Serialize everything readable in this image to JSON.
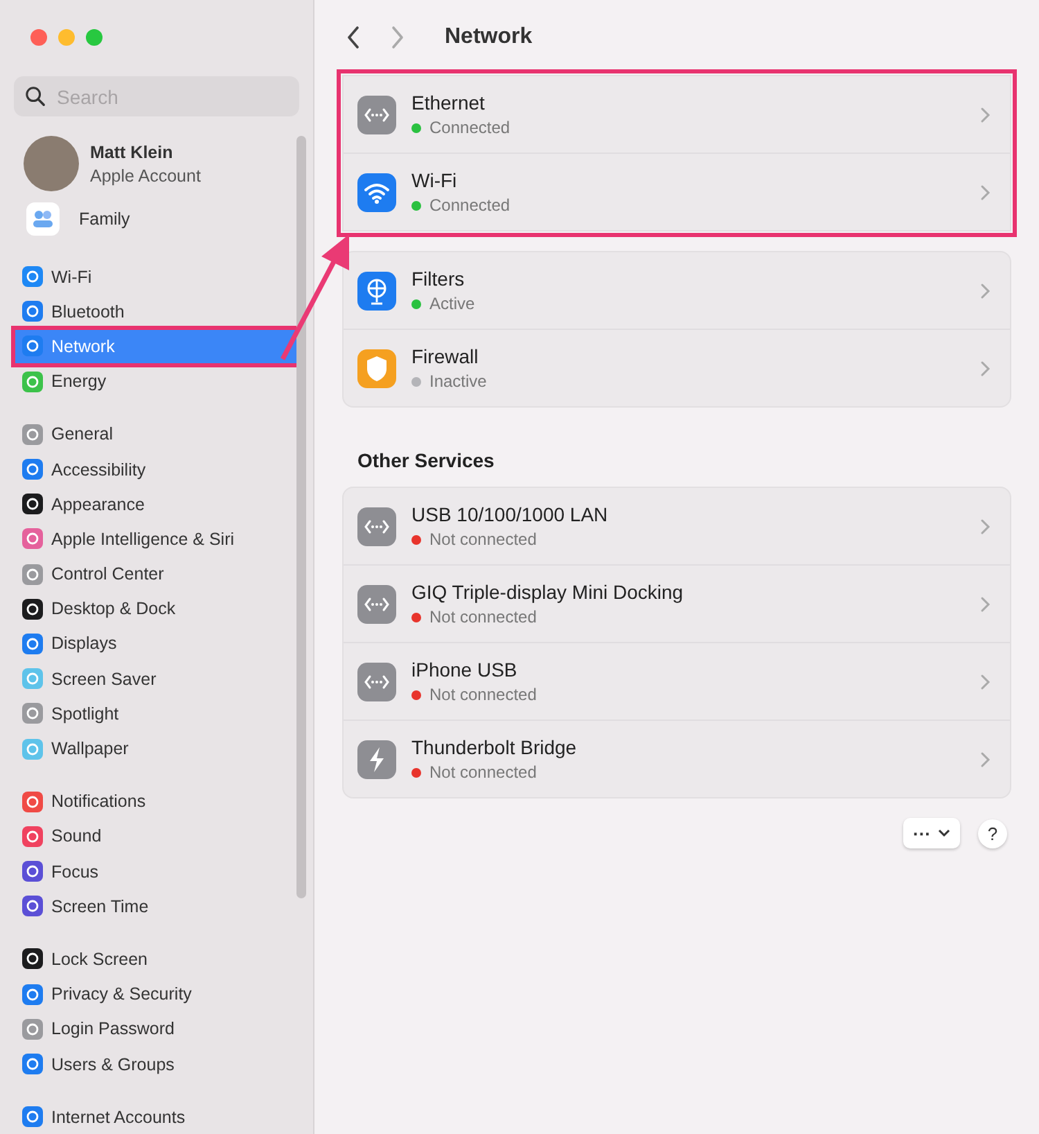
{
  "window": {
    "title": "Network"
  },
  "sidebar": {
    "search": {
      "placeholder": "Search"
    },
    "account": {
      "name": "Matt Klein",
      "subtitle": "Apple Account"
    },
    "family": {
      "label": "Family"
    },
    "groups": [
      {
        "items": [
          {
            "label": "Wi-Fi",
            "color": "#1e88f5",
            "selected": false,
            "highlighted": false
          },
          {
            "label": "Bluetooth",
            "color": "#1e7cf0",
            "selected": false,
            "highlighted": false
          },
          {
            "label": "Network",
            "color": "#1e7cf0",
            "selected": true,
            "highlighted": true
          },
          {
            "label": "Energy",
            "color": "#3cc24a",
            "selected": false,
            "highlighted": false
          }
        ]
      },
      {
        "items": [
          {
            "label": "General",
            "color": "#9a9a9e",
            "selected": false,
            "highlighted": false
          },
          {
            "label": "Accessibility",
            "color": "#1e7cf0",
            "selected": false,
            "highlighted": false
          },
          {
            "label": "Appearance",
            "color": "#1c1c1e",
            "selected": false,
            "highlighted": false
          },
          {
            "label": "Apple Intelligence & Siri",
            "color": "#e5619c",
            "selected": false,
            "highlighted": false
          },
          {
            "label": "Control Center",
            "color": "#9a9a9e",
            "selected": false,
            "highlighted": false
          },
          {
            "label": "Desktop & Dock",
            "color": "#1c1c1e",
            "selected": false,
            "highlighted": false
          },
          {
            "label": "Displays",
            "color": "#1e7cf0",
            "selected": false,
            "highlighted": false
          },
          {
            "label": "Screen Saver",
            "color": "#5ec3ea",
            "selected": false,
            "highlighted": false
          },
          {
            "label": "Spotlight",
            "color": "#9a9a9e",
            "selected": false,
            "highlighted": false
          },
          {
            "label": "Wallpaper",
            "color": "#5ec3ea",
            "selected": false,
            "highlighted": false
          }
        ]
      },
      {
        "items": [
          {
            "label": "Notifications",
            "color": "#f04a45",
            "selected": false,
            "highlighted": false
          },
          {
            "label": "Sound",
            "color": "#f0425f",
            "selected": false,
            "highlighted": false
          },
          {
            "label": "Focus",
            "color": "#5b4fd6",
            "selected": false,
            "highlighted": false
          },
          {
            "label": "Screen Time",
            "color": "#5b4fd6",
            "selected": false,
            "highlighted": false
          }
        ]
      },
      {
        "items": [
          {
            "label": "Lock Screen",
            "color": "#1c1c1e",
            "selected": false,
            "highlighted": false
          },
          {
            "label": "Privacy & Security",
            "color": "#1e7cf0",
            "selected": false,
            "highlighted": false
          },
          {
            "label": "Login Password",
            "color": "#9a9a9e",
            "selected": false,
            "highlighted": false
          },
          {
            "label": "Users & Groups",
            "color": "#1e7cf0",
            "selected": false,
            "highlighted": false
          }
        ]
      },
      {
        "items": [
          {
            "label": "Internet Accounts",
            "color": "#1e7cf0",
            "selected": false,
            "highlighted": false
          }
        ]
      }
    ]
  },
  "main": {
    "groups": [
      {
        "highlighted": true,
        "services": [
          {
            "kind": "ethernet",
            "name": "Ethernet",
            "status": "Connected",
            "color": "#2ac140"
          },
          {
            "kind": "wifi",
            "name": "Wi-Fi",
            "status": "Connected",
            "color": "#2ac140"
          }
        ]
      },
      {
        "highlighted": false,
        "services": [
          {
            "kind": "filters",
            "name": "Filters",
            "status": "Active",
            "color": "#2ac140"
          },
          {
            "kind": "firewall",
            "name": "Firewall",
            "status": "Inactive",
            "color": "#b4b4b8"
          }
        ]
      },
      {
        "heading": "Other Services",
        "highlighted": false,
        "services": [
          {
            "kind": "ethernet",
            "name": "USB 10/100/1000 LAN",
            "status": "Not connected",
            "color": "#e8342c"
          },
          {
            "kind": "ethernet",
            "name": "GIQ Triple-display Mini Docking",
            "status": "Not connected",
            "color": "#e8342c"
          },
          {
            "kind": "ethernet",
            "name": "iPhone USB",
            "status": "Not connected",
            "color": "#e8342c"
          },
          {
            "kind": "thunderbolt",
            "name": "Thunderbolt Bridge",
            "status": "Not connected",
            "color": "#e8342c"
          }
        ]
      }
    ],
    "actions_button": {
      "label": "···"
    },
    "help_button": {
      "label": "?"
    }
  }
}
